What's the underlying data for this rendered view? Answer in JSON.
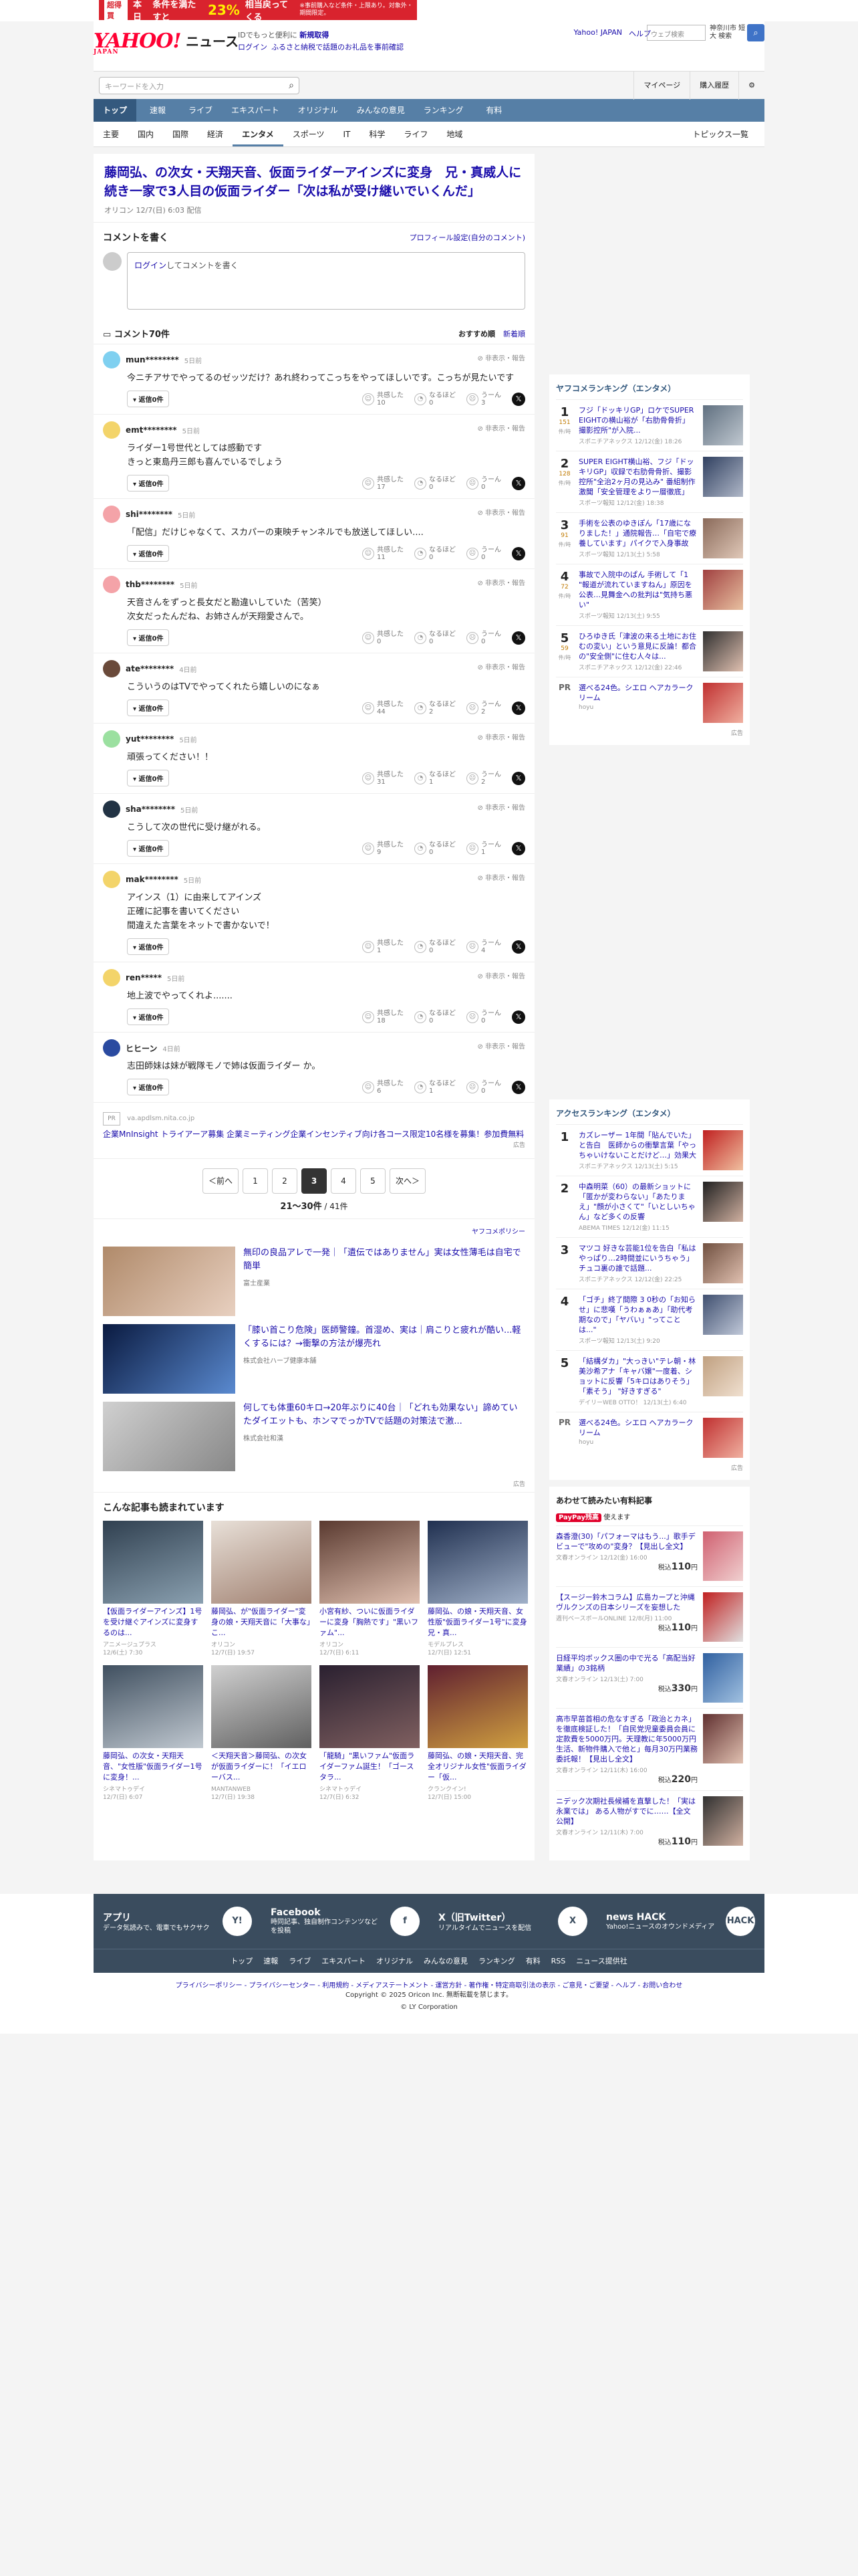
{
  "top_ad": {
    "badge": "超得買",
    "text1": "本日",
    "text2": "条件を満たすと",
    "big": "23%",
    "text3": "相当戻ってくる",
    "small": "※事前購入など条件・上限あり。対象外・期間限定。"
  },
  "header": {
    "logo": "YAHOO!",
    "logo_sub": "JAPAN",
    "news": "ニュース",
    "line1": "IDでもっと便利に",
    "line1_link": "新規取得",
    "login": "ログイン",
    "furusato": "ふるさと納税で話題のお礼品を事前確認",
    "links": [
      "Yahoo! JAPAN",
      "ヘルプ"
    ],
    "search_placeholder": "ウェブ検索",
    "location": "神奈川市 短大 検索"
  },
  "search": {
    "placeholder": "キーワードを入力",
    "mypage": "マイページ",
    "purchase": "購入履歴"
  },
  "nav1": [
    "トップ",
    "速報",
    "ライブ",
    "エキスパート",
    "オリジナル",
    "みんなの意見",
    "ランキング",
    "有料"
  ],
  "nav2": [
    "主要",
    "国内",
    "国際",
    "経済",
    "エンタメ",
    "スポーツ",
    "IT",
    "科学",
    "ライフ",
    "地域"
  ],
  "nav2_active": "エンタメ",
  "nav2_right": "トピックス一覧",
  "article": {
    "title": "藤岡弘、の次女・天翔天音、仮面ライダーアインズに変身　兄・真威人に続き一家で3人目の仮面ライダー「次は私が受け継いでいくんだ」",
    "source": "オリコン",
    "date": "12/7(日) 6:03 配信"
  },
  "write": {
    "heading": "コメントを書く",
    "profile_link": "プロフィール設定(自分のコメント)",
    "login_word": "ログイン",
    "placeholder": "してコメントを書く"
  },
  "comments_head": {
    "count": "コメント70件",
    "sort1": "おすすめ順",
    "sort2": "新着順"
  },
  "comment_labels": {
    "hide": "非表示・報告",
    "reply_suffix": "返信",
    "agree": "共感した",
    "understand": "なるほど",
    "hmm": "うーん"
  },
  "comments": [
    {
      "name": "mun********",
      "time": "5日前",
      "body": "今ニチアサでやってるのゼッツだけ？あれ終わってこっちをやってほしいです。こっちが見たいです",
      "replies": "0件",
      "agree": "10",
      "understand": "0",
      "hmm": "3",
      "color": "#7fd0f0"
    },
    {
      "name": "emt********",
      "time": "5日前",
      "body": "ライダー1号世代としては感動です\nきっと東島丹三郎も喜んでいるでしょう",
      "replies": "0件",
      "agree": "17",
      "understand": "0",
      "hmm": "0",
      "color": "#f3d46a"
    },
    {
      "name": "shi********",
      "time": "5日前",
      "body": "「配信」だけじゃなくて、スカパーの東映チャンネルでも放送してほしい....",
      "replies": "0件",
      "agree": "11",
      "understand": "0",
      "hmm": "0",
      "color": "#f4a3a8"
    },
    {
      "name": "thb********",
      "time": "5日前",
      "body": "天音さんをずっと長女だと勘違いしていた（苦笑）\n次女だったんだね、お姉さんが天翔愛さんで。",
      "replies": "0件",
      "agree": "0",
      "understand": "0",
      "hmm": "0",
      "color": "#f4a3a8"
    },
    {
      "name": "ate********",
      "time": "4日前",
      "body": "こういうのはTVでやってくれたら嬉しいのになぁ",
      "replies": "0件",
      "agree": "44",
      "understand": "2",
      "hmm": "2",
      "color": "#6a4a3a"
    },
    {
      "name": "yut********",
      "time": "5日前",
      "body": "頑張ってください！！",
      "replies": "0件",
      "agree": "31",
      "understand": "1",
      "hmm": "2",
      "color": "#9be0a0"
    },
    {
      "name": "sha********",
      "time": "5日前",
      "body": "こうして次の世代に受け継がれる。",
      "replies": "0件",
      "agree": "9",
      "understand": "0",
      "hmm": "1",
      "color": "#223344"
    },
    {
      "name": "mak********",
      "time": "5日前",
      "body": "アインス（1）に由来してアインズ\n正確に記事を書いてください\n間違えた言葉をネットで書かないで！",
      "replies": "0件",
      "agree": "1",
      "understand": "0",
      "hmm": "4",
      "color": "#f3d46a"
    },
    {
      "name": "ren*****",
      "time": "5日前",
      "body": "地上波でやってくれよ.......",
      "replies": "0件",
      "agree": "18",
      "understand": "0",
      "hmm": "0",
      "color": "#f3d46a"
    },
    {
      "name": "ヒヒーン",
      "time": "4日前",
      "body": "志田師妹は妹が戦隊モノで姉は仮面ライダー か。",
      "replies": "0件",
      "agree": "6",
      "understand": "1",
      "hmm": "0",
      "color": "#2a4aa0"
    }
  ],
  "pr_block": {
    "icon": "PR",
    "domain": "va.apdlsm.nita.co.jp",
    "text": "企業MnInsight トライアーア募集 企業ミーティング企業インセンティブ向け各コース限定10名様を募集！参加費無料",
    "ad": "広告"
  },
  "pagination": {
    "prev": "＜前へ",
    "pages": [
      "1",
      "2",
      "3",
      "4",
      "5"
    ],
    "active": "3",
    "next": "次へ＞",
    "count": "21〜30件",
    "total": "41件"
  },
  "policy": "ヤフコメポリシー",
  "ads": [
    {
      "title": "無印の良品アレで一発｜「遺伝ではありません」実は女性薄毛は自宅で簡単",
      "src": "富士産業",
      "colors": [
        "#b08a6a",
        "#e8d0c0"
      ]
    },
    {
      "title": "「膝い首こり危険」医師警鐘。首湿め、実は｜肩こりと疲れが酷い...軽くするには？→衝撃の方法が爆売れ",
      "src": "株式会社ハーブ健康本舗",
      "colors": [
        "#0a1a40",
        "#5a8ad0"
      ]
    },
    {
      "title": "何しても体重60キロ→20年ぶりに40台｜「どれも効果ない」諦めていたダイエットも、ホンマでっかTVで話題の対策法で激...",
      "src": "株式会社和漢",
      "colors": [
        "#d0d0d0",
        "#888"
      ]
    }
  ],
  "ads_label": "広告",
  "readalso": {
    "heading": "こんな記事も読まれています",
    "items": [
      {
        "title": "【仮面ライダーアインズ】1号を受け継ぐアインズに変身するのは...",
        "src": "アニメージュプラス",
        "date": "12/6(土) 7:30",
        "colors": [
          "#304050",
          "#8aa0b0"
        ]
      },
      {
        "title": "藤岡弘、が\"仮面ライダー\"変身の娘・天翔天音に「大事な」こ...",
        "src": "オリコン",
        "date": "12/7(日) 19:57",
        "colors": [
          "#e8e0d8",
          "#a08070"
        ]
      },
      {
        "title": "小宮有紗、ついに仮面ライダーに変身「胸熱です」\"黒いファム\"...",
        "src": "オリコン",
        "date": "12/7(日) 6:11",
        "colors": [
          "#5a3a30",
          "#e0c0b0"
        ]
      },
      {
        "title": "藤岡弘、の娘・天翔天音、女性版\"仮面ライダー1号\"に変身 兄・真...",
        "src": "モデルプレス",
        "date": "12/7(日) 12:51",
        "colors": [
          "#203050",
          "#a0b0c8"
        ]
      },
      {
        "title": "藤岡弘、の次女・天翔天音、\"女性版\"仮面ライダー1号に変身！...",
        "src": "シネマトゥデイ",
        "date": "12/7(日) 6:07",
        "colors": [
          "#405060",
          "#c0c8d0"
        ]
      },
      {
        "title": "＜天翔天音＞藤岡弘、の次女が仮面ライダーに！「イエローバス...",
        "src": "MANTANWEB",
        "date": "12/7(日) 19:38",
        "colors": [
          "#d0d0d0",
          "#606060"
        ]
      },
      {
        "title": "「龍騎」\"黒いファム\"仮面ライダーファム誕生！「ゴースタラ...",
        "src": "シネマトゥデイ",
        "date": "12/7(日) 6:32",
        "colors": [
          "#2a2030",
          "#806060"
        ]
      },
      {
        "title": "藤岡弘、の娘・天翔天音、完全オリジナル女性\"仮面ライダー「仮...",
        "src": "クランクイン!",
        "date": "12/7(日) 15:00",
        "colors": [
          "#602030",
          "#d0a040"
        ]
      }
    ]
  },
  "ranking1": {
    "heading": "ヤフコメランキング（エンタメ）",
    "items": [
      {
        "n": "1",
        "count": "151",
        "unit": "件/時",
        "title": "フジ「ドッキリGP」ロケでSUPER EIGHTの横山裕が「右肋骨骨折」 撮影控所\"が入院...",
        "meta": "スポニチアネックス 12/12(金) 18:26",
        "colors": [
          "#607080",
          "#c0c8d0"
        ]
      },
      {
        "n": "2",
        "count": "128",
        "unit": "件/時",
        "title": "SUPER EIGHT横山裕、フジ「ドッキリGP」収録で右肋骨骨折、撮影控所\"全治2ヶ月の見込み\" 番組制作激聞「安全管理をより一層徹底」",
        "meta": "スポーツ報知 12/12(金) 18:38",
        "colors": [
          "#304060",
          "#b0b8c8"
        ]
      },
      {
        "n": "3",
        "count": "91",
        "unit": "件/時",
        "title": "手術を公表のゆきぽん「17歳になりました！」通院報告…「自宅で療養しています」パイクで入身事故",
        "meta": "スポーツ報知 12/13(土) 5:58",
        "colors": [
          "#8a6a5a",
          "#e0c8b8"
        ]
      },
      {
        "n": "4",
        "count": "72",
        "unit": "件/時",
        "title": "事故で入院中のぱん 手術して「1 \"報道が流れていますねん」原因を公表…見舞金への批判は\"気持ち悪い\"",
        "meta": "スポーツ報知 12/13(土) 9:55",
        "colors": [
          "#a04040",
          "#e8c0a0"
        ]
      },
      {
        "n": "5",
        "count": "59",
        "unit": "件/時",
        "title": "ひろゆき氏「津波の来る土地にお住むの変い」という意見に反論！都合の\"安全側\"に住む人々は...",
        "meta": "スポニチアネックス 12/12(金) 22:46",
        "colors": [
          "#303030",
          "#e0c0b0"
        ]
      }
    ],
    "pr": {
      "label": "PR",
      "title": "選べる24色。シエロ ヘアカラークリーム",
      "src": "hoyu"
    },
    "ad": "広告"
  },
  "ranking2": {
    "heading": "アクセスランキング（エンタメ）",
    "items": [
      {
        "n": "1",
        "title": "カズレーザー 1年間「貼んでいた」と告白　医師からの衝撃言葉「やっちゃいけないことだけど…」効果大",
        "meta": "スポニチアネックス 12/13(土) 5:15",
        "colors": [
          "#c02020",
          "#f0c0a0"
        ]
      },
      {
        "n": "2",
        "title": "中森明菜（60）の最新ショットに「匿かが変わらない」「あたりまえ」\"顔が小さくて\"「いとしいちゃん」など多くの反響",
        "meta": "ABEMA TIMES 12/12(金) 11:15",
        "colors": [
          "#202020",
          "#d0b0a0"
        ]
      },
      {
        "n": "3",
        "title": "マツコ 好きな芸能1位を告白「私はやっぱり…2時間並にいうちゃう」 チュコ裏の誰で話題...",
        "meta": "スポニチアネックス 12/12(金) 22:25",
        "colors": [
          "#705040",
          "#e0c0b0"
        ]
      },
      {
        "n": "4",
        "title": "「ゴチ」終了間際 3 0秒の「お知らせ」に悲嘆「うわぁぁあ」「助代考期なので」「ヤバい」\"ってことは...\"",
        "meta": "スポーツ報知 12/13(土) 9:20",
        "colors": [
          "#405070",
          "#c0c8d8"
        ]
      },
      {
        "n": "5",
        "title": "「結構ダカ」\"大っきい\"テレ朝・林美沙希アナ「キャバ嬢\"一度着、ショットに反響「5キロはありそう」「素そう」 \"好きすぎる\"",
        "meta": "デイリーWEB OTTO！ 12/13(土) 6:40",
        "colors": [
          "#c0a080",
          "#f0e0d0"
        ]
      }
    ],
    "pr": {
      "label": "PR",
      "title": "選べる24色。シエロ ヘアカラークリーム",
      "src": "hoyu"
    },
    "ad": "広告"
  },
  "paid": {
    "heading": "あわせて読みたい有料記事",
    "paypay": "PayPay残高",
    "paypay_suffix": "使えます",
    "price_prefix": "税込",
    "items": [
      {
        "title": "森香澄(30)「パフォーマはもう...」歌手デビューで\"攻めの\"変身？【見出し全文】",
        "meta": "文春オンライン 12/12(金) 16:00",
        "price": "110",
        "unit": "円",
        "colors": [
          "#d06070",
          "#f0d0d0"
        ]
      },
      {
        "title": "【スージー鈴木コラム】広島カープと沖縄ヴルクンズの日本シリーズを妄想した",
        "meta": "週刊ベースボールONLINE 12/8(月) 11:00",
        "price": "110",
        "unit": "円",
        "colors": [
          "#c02020",
          "#e0e0e0"
        ]
      },
      {
        "title": "日経平均ボックス圏の中で光る「高配当好業績」の3銘柄",
        "meta": "文春オンライン 12/13(土) 7:00",
        "price": "330",
        "unit": "円",
        "colors": [
          "#3060a0",
          "#a0c0e0"
        ]
      },
      {
        "title": "高市早苗首相の危なすぎる「政治とカネ」を徹底検証した！「自民党児童委員会員に定款費を5000万円。天理教に年5000万円生活、新物件購入で他と」毎月30万円業務委託報！【見出し全文】",
        "meta": "文春オンライン 12/11(木) 16:00",
        "price": "220",
        "unit": "円",
        "colors": [
          "#603030",
          "#e0c0b0"
        ]
      },
      {
        "title": "ニデック次期社長候補を直撃した！「実は永業では」 ある人物がすでに……【全文公開】",
        "meta": "文春オンライン 12/11(木) 7:00",
        "price": "110",
        "unit": "円",
        "colors": [
          "#303030",
          "#d0b0a0"
        ]
      }
    ]
  },
  "footer": {
    "cols": [
      {
        "name": "アプリ",
        "desc": "データ気読みで、電車でもサクサク",
        "logo": "Y!"
      },
      {
        "name": "Facebook",
        "desc": "時同記事、独自制作コンテンツなどを投稿",
        "logo": "f"
      },
      {
        "name": "X（旧Twitter）",
        "desc": "リアルタイムでニュースを配信",
        "logo": "X"
      },
      {
        "name": "news HACK",
        "desc": "Yahoo!ニュースのオウンドメディア",
        "logo": "HACK"
      }
    ],
    "nav": [
      "トップ",
      "速報",
      "ライブ",
      "エキスパート",
      "オリジナル",
      "みんなの意見",
      "ランキング",
      "有料",
      "RSS",
      "ニュース提供社"
    ],
    "links": "プライバシーポリシー - プライバシーセンター - 利用規約 - メディアステートメント - 運営方針 - 著作権・特定商取引法の表示 - ご意見・ご要望 - ヘルプ - お問い合わせ",
    "copyright": "Copyright © 2025 Oricon Inc. 無断転載を禁じます。",
    "corp": "© LY Corporation"
  }
}
